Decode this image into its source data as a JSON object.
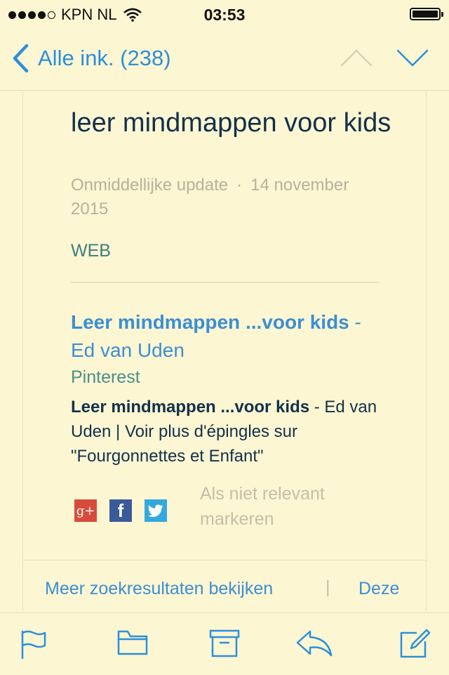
{
  "status_bar": {
    "carrier": "KPN NL",
    "signal_bars": 4,
    "signal_max": 5,
    "time": "03:53",
    "battery_level": 1.0
  },
  "nav": {
    "back_label": "Alle ink. (238)",
    "icons": [
      "chevron-left-icon",
      "chevron-up-icon",
      "chevron-down-icon"
    ]
  },
  "alert": {
    "title": "leer mindmappen voor kids",
    "update_type": "Onmiddellijke update",
    "separator": "·",
    "date": "14 november 2015",
    "section": "WEB"
  },
  "result": {
    "title_bold": "Leer mindmappen ...voor kids",
    "title_rest": " - Ed van Uden",
    "source": "Pinterest",
    "snippet_bold": "Leer mindmappen ...voor kids",
    "snippet_rest": " - Ed van Uden | Voir plus d'épingles sur \"Fourgonnettes et Enfant\"",
    "share": {
      "google": "g+",
      "facebook": "f",
      "twitter_icon": "twitter-bird-icon"
    },
    "not_relevant": "Als niet relevant markeren"
  },
  "footer_links": {
    "more_results": "Meer zoekresultaten bekijken",
    "separator": "|",
    "second": "Deze"
  },
  "toolbar": {
    "icons": [
      "flag-icon",
      "folder-icon",
      "archive-icon",
      "reply-icon",
      "compose-icon"
    ]
  },
  "colors": {
    "background": "#fdf6d3",
    "link": "#2b90d9",
    "title": "#12304a",
    "muted": "#b6b29a",
    "source": "#4a9089"
  }
}
